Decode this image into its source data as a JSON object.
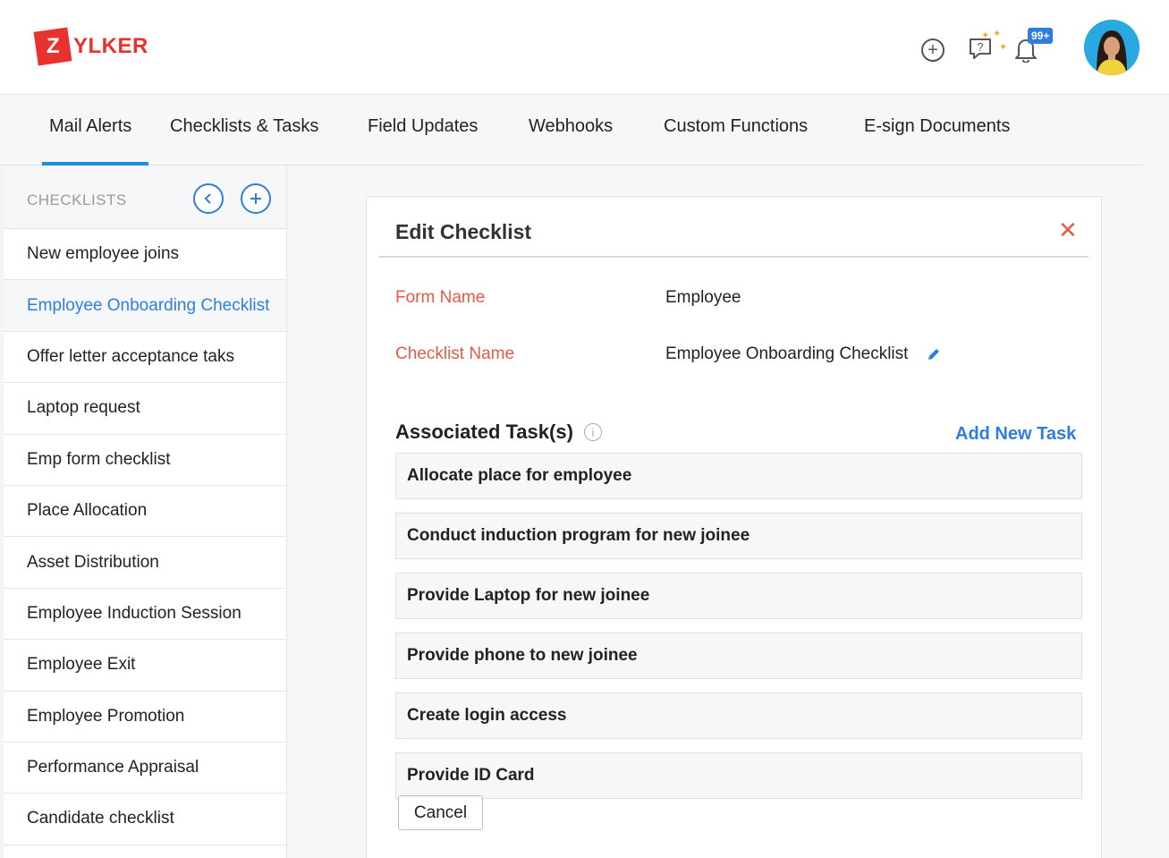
{
  "brand": {
    "logo_letter": "Z",
    "logo_rest": "YLKER",
    "color": "#e8322e"
  },
  "header": {
    "icons": [
      "add-circle-icon",
      "help-icon",
      "bell-icon"
    ],
    "notification_badge": "99+"
  },
  "tabs": [
    {
      "label": "Mail Alerts",
      "active": true
    },
    {
      "label": "Checklists & Tasks",
      "active": false
    },
    {
      "label": "Field Updates",
      "active": false
    },
    {
      "label": "Webhooks",
      "active": false
    },
    {
      "label": "Custom Functions",
      "active": false
    },
    {
      "label": "E-sign Documents",
      "active": false
    }
  ],
  "sidebar": {
    "heading": "CHECKLISTS",
    "items": [
      {
        "label": "New employee joins"
      },
      {
        "label": "Employee Onboarding Checklist",
        "active": true
      },
      {
        "label": "Offer letter acceptance taks"
      },
      {
        "label": "Laptop request"
      },
      {
        "label": "Emp form checklist"
      },
      {
        "label": "Place Allocation"
      },
      {
        "label": "Asset Distribution"
      },
      {
        "label": "Employee Induction Session"
      },
      {
        "label": "Employee Exit"
      },
      {
        "label": "Employee Promotion"
      },
      {
        "label": "Performance Appraisal"
      },
      {
        "label": "Candidate checklist"
      }
    ]
  },
  "panel": {
    "title": "Edit Checklist",
    "form_name_label": "Form Name",
    "form_name_value": "Employee",
    "checklist_name_label": "Checklist Name",
    "checklist_name_value": "Employee Onboarding Checklist",
    "associated_title": "Associated Task(s)",
    "add_task_label": "Add New Task",
    "tasks": [
      "Allocate place for employee",
      "Conduct induction program for new joinee",
      "Provide Laptop for new joinee",
      "Provide phone to new joinee",
      "Create login access",
      "Provide ID Card"
    ],
    "cancel_label": "Cancel"
  },
  "colors": {
    "accent": "#2f7de1",
    "tab_indicator": "#1a8fdd",
    "label": "#e25b47"
  }
}
